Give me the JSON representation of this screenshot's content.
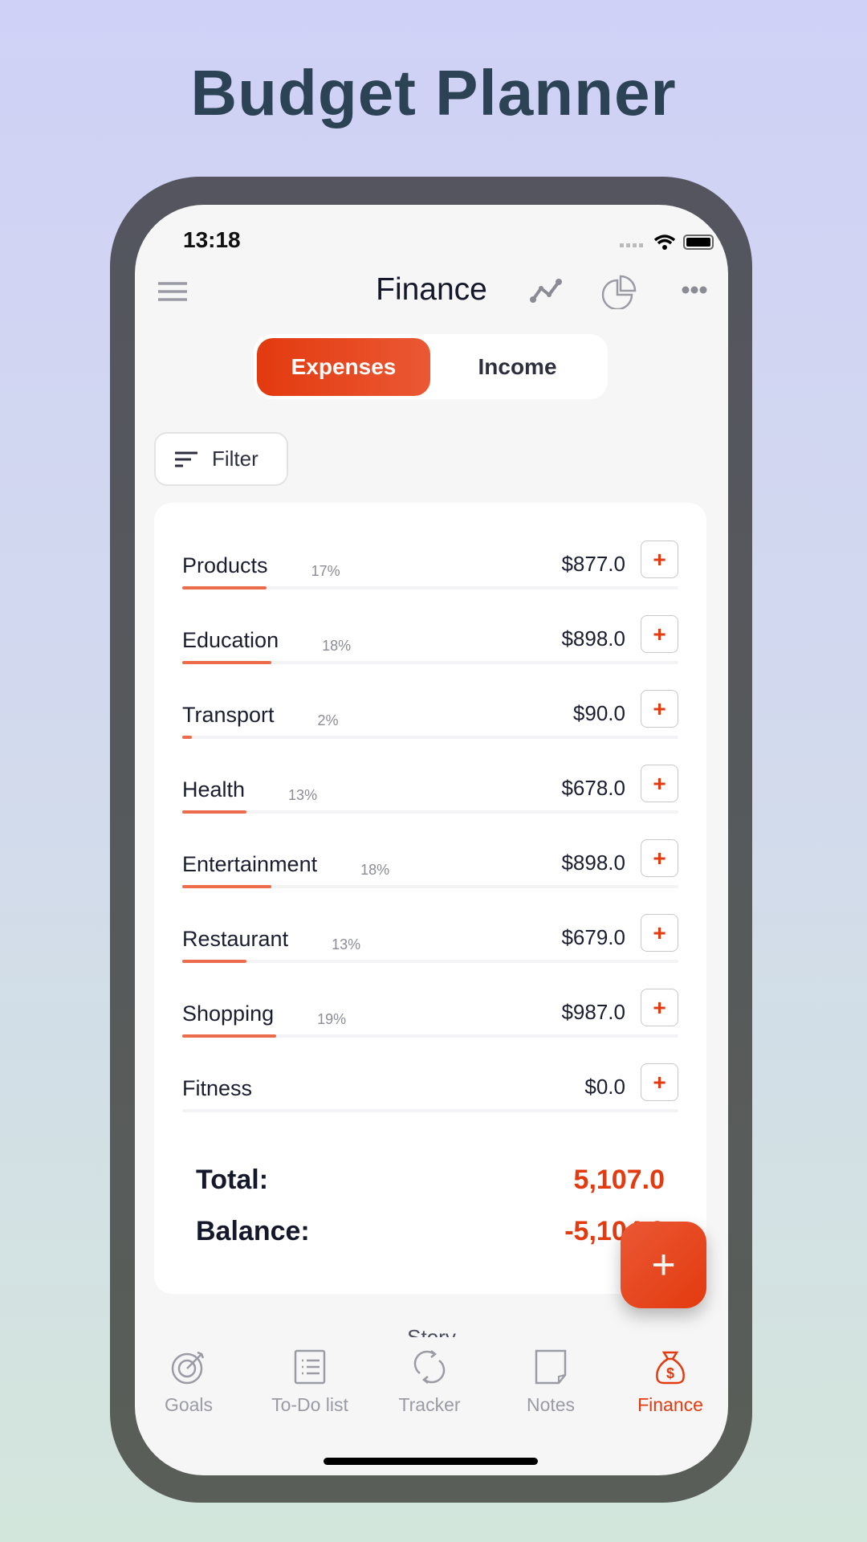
{
  "promo": {
    "title": "Budget Planner"
  },
  "status_bar": {
    "time": "13:18"
  },
  "header": {
    "title": "Finance",
    "icons": [
      "menu-icon",
      "trend-chart-icon",
      "pie-chart-icon",
      "more-icon"
    ]
  },
  "segment": {
    "expenses": "Expenses",
    "income": "Income",
    "selected": "Expenses"
  },
  "filter": {
    "label": "Filter"
  },
  "categories": [
    {
      "name": "Products",
      "percent": "17%",
      "amount": "$877.0",
      "fill": 17
    },
    {
      "name": "Education",
      "percent": "18%",
      "amount": "$898.0",
      "fill": 18
    },
    {
      "name": "Transport",
      "percent": "2%",
      "amount": "$90.0",
      "fill": 2
    },
    {
      "name": "Health",
      "percent": "13%",
      "amount": "$678.0",
      "fill": 13
    },
    {
      "name": "Entertainment",
      "percent": "18%",
      "amount": "$898.0",
      "fill": 18
    },
    {
      "name": "Restaurant",
      "percent": "13%",
      "amount": "$679.0",
      "fill": 13
    },
    {
      "name": "Shopping",
      "percent": "19%",
      "amount": "$987.0",
      "fill": 19
    },
    {
      "name": "Fitness",
      "percent": "",
      "amount": "$0.0",
      "fill": 0
    }
  ],
  "add_label": "+",
  "summary": {
    "total_label": "Total:",
    "total_value": "5,107.0",
    "balance_label": "Balance:",
    "balance_value": "-5,104.0"
  },
  "fab": {
    "label": "+"
  },
  "story": {
    "label": "Story"
  },
  "tabs": [
    {
      "label": "Goals",
      "icon": "target-icon"
    },
    {
      "label": "To-Do list",
      "icon": "list-icon"
    },
    {
      "label": "Tracker",
      "icon": "refresh-icon"
    },
    {
      "label": "Notes",
      "icon": "note-icon"
    },
    {
      "label": "Finance",
      "icon": "money-bag-icon",
      "active": true
    }
  ],
  "colors": {
    "accent": "#e33a0f",
    "text": "#15172b",
    "bar": "#ec6b4a"
  }
}
